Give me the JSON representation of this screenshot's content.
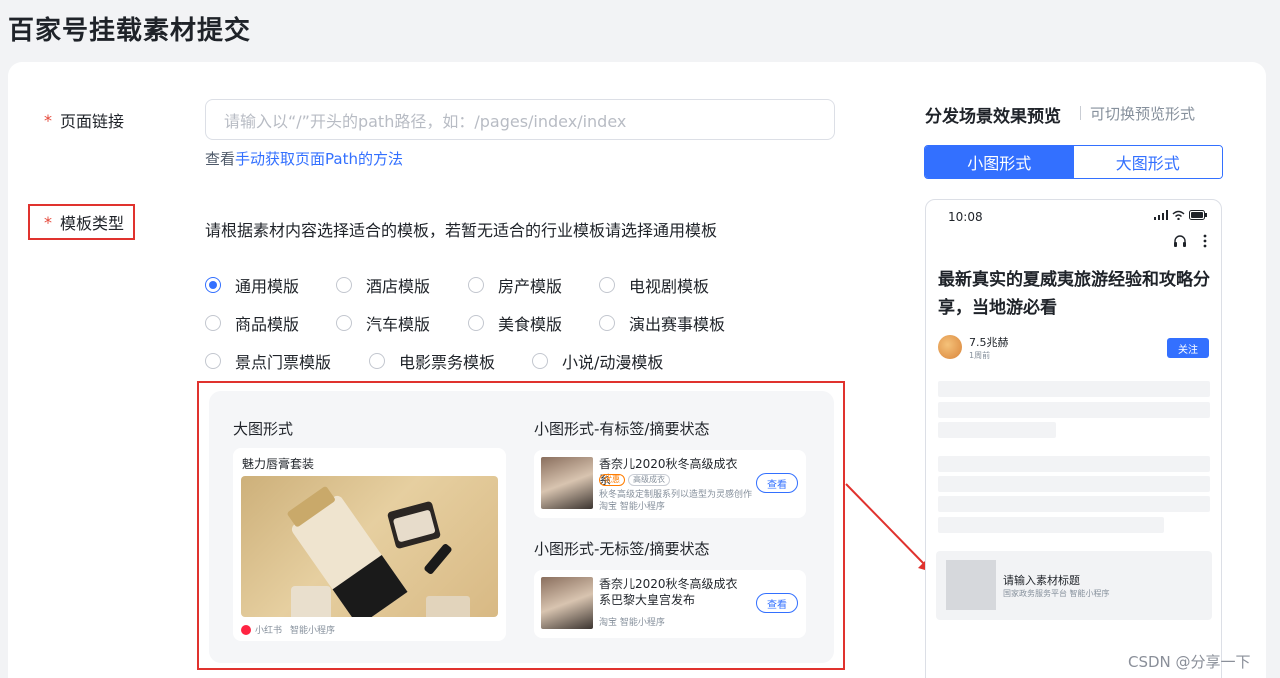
{
  "page": {
    "title": "百家号挂载素材提交"
  },
  "form": {
    "link_label": "页面链接",
    "link_placeholder": "请输入以“/”开头的path路径，如：/pages/index/index",
    "help_prefix": "查看",
    "help_link": "手动获取页面Path的方法",
    "template_label": "模板类型",
    "template_desc": "请根据素材内容选择适合的模板，若暂无适合的行业模板请选择通用模板",
    "template_options": [
      [
        "通用模版",
        "酒店模版",
        "房产模版",
        "电视剧模板"
      ],
      [
        "商品模版",
        "汽车模版",
        "美食模版",
        "演出赛事模板"
      ],
      [
        "景点门票模版",
        "电影票务模板",
        "小说/动漫模板"
      ]
    ],
    "selected_template": "通用模版"
  },
  "example": {
    "big_title": "大图形式",
    "big_card_title": "魅力唇膏套装",
    "big_card_source": "小红书",
    "big_card_app": "智能小程序",
    "small_tag_title": "小图形式-有标签/摘要状态",
    "small_notag_title": "小图形式-无标签/摘要状态",
    "card1": {
      "title": "香奈儿2020秋冬高级成衣系",
      "tag1": "优惠",
      "tag2": "高级成衣",
      "summary": "秋冬高级定制服系列以造型为灵感创作",
      "source": "淘宝  智能小程序",
      "btn": "查看"
    },
    "card2": {
      "title": "香奈儿2020秋冬高级成衣系巴黎大皇宫发布",
      "source": "淘宝  智能小程序",
      "btn": "查看"
    }
  },
  "preview": {
    "title": "分发场景效果预览",
    "subtitle": "可切换预览形式",
    "tab_small": "小图形式",
    "tab_big": "大图形式",
    "time": "10:08",
    "headline": "最新真实的夏威夷旅游经验和攻略分享，当地游必看",
    "author": "7.5兆赫",
    "author_time": "1周前",
    "follow": "关注",
    "material_title": "请输入素材标题",
    "material_source": "国家政务服务平台  智能小程序"
  },
  "watermark": "CSDN @分享一下",
  "colors": {
    "accent": "#3370ff",
    "highlight_border": "#e0322e",
    "required": "#e5483a"
  }
}
